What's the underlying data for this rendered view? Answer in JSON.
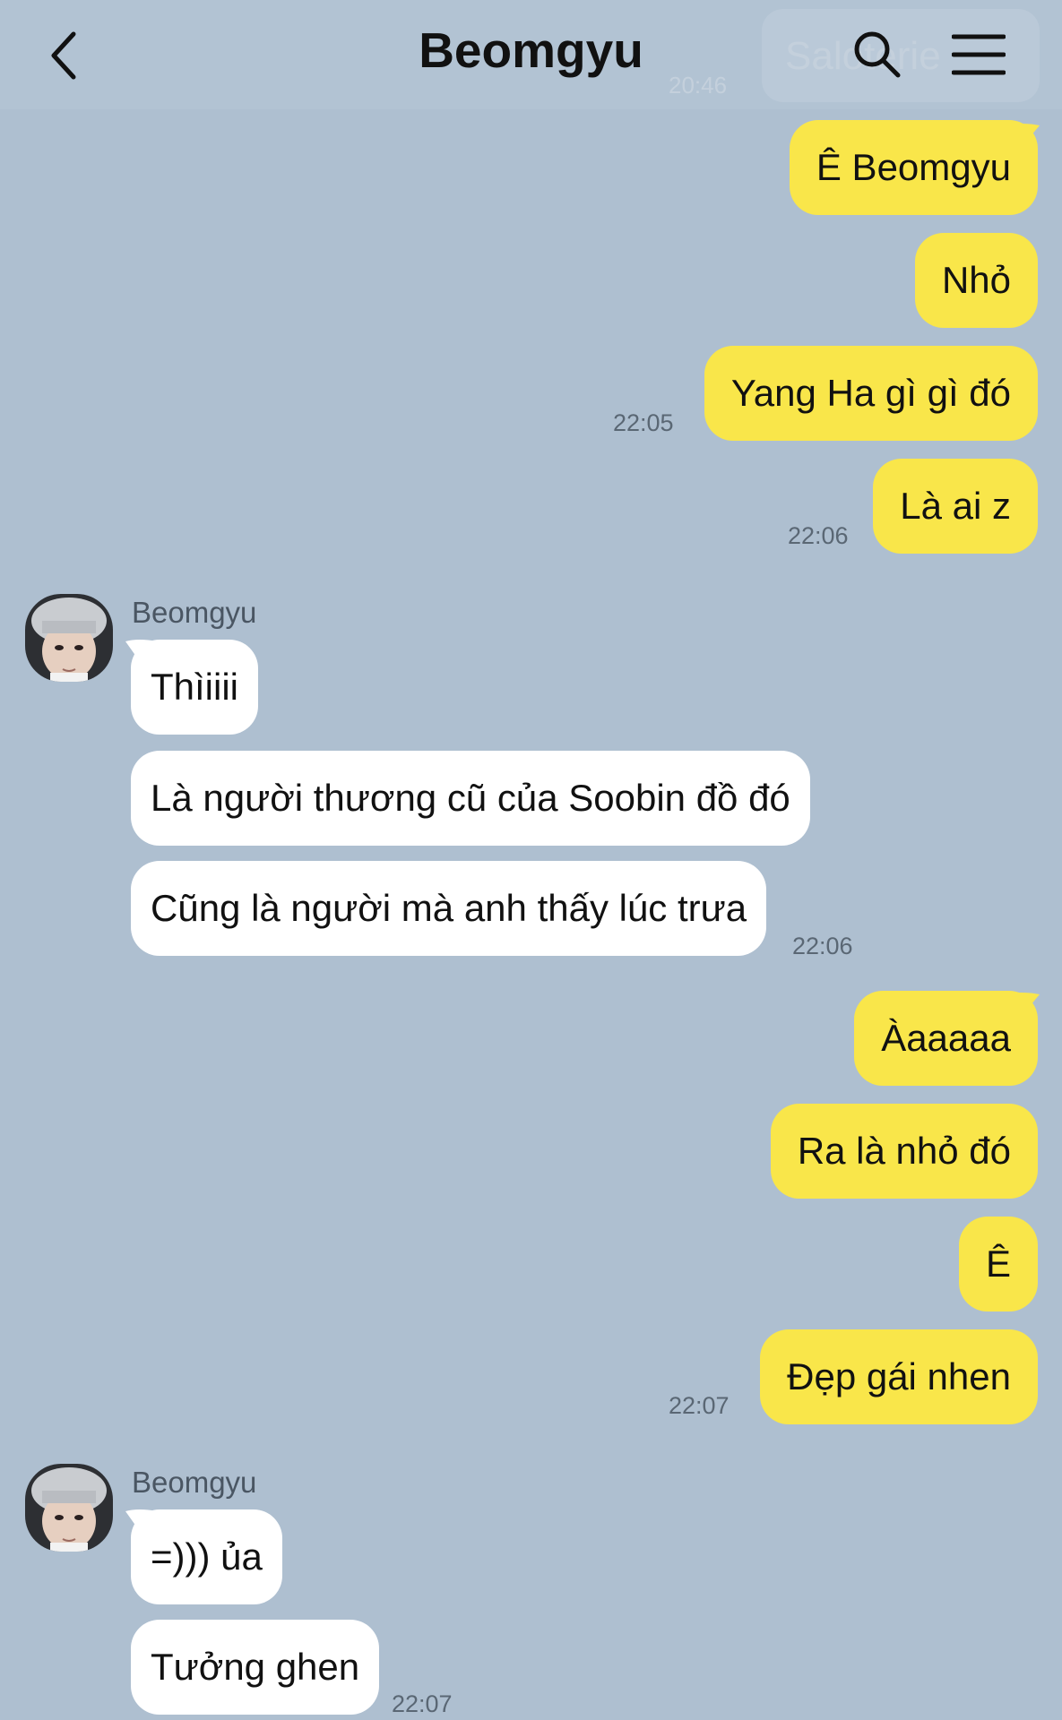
{
  "header": {
    "title": "Beomgyu",
    "ghost_text": "Saloterie",
    "ghost_time": "20:46"
  },
  "messages": {
    "m1": "Ê Beomgyu",
    "m2": "Nhỏ",
    "m3": "Yang Ha gì gì đó",
    "t3": "22:05",
    "m4": "Là ai z",
    "t4": "22:06",
    "sender1": "Beomgyu",
    "r1": "Thìiiii",
    "r2": "Là người thương cũ của Soobin đồ đó",
    "r3": "Cũng là người mà anh thấy lúc trưa",
    "tr3": "22:06",
    "m5": "Àaaaaa",
    "m6": "Ra là nhỏ đó",
    "m7": "Ê",
    "m8": "Đẹp gái nhen",
    "t8": "22:07",
    "sender2": "Beomgyu",
    "r4": "=))) ủa",
    "r5": "Tưởng ghen",
    "tr5": "22:07"
  },
  "colors": {
    "background": "#aebfd0",
    "my_bubble": "#f9e64a",
    "their_bubble": "#ffffff"
  }
}
